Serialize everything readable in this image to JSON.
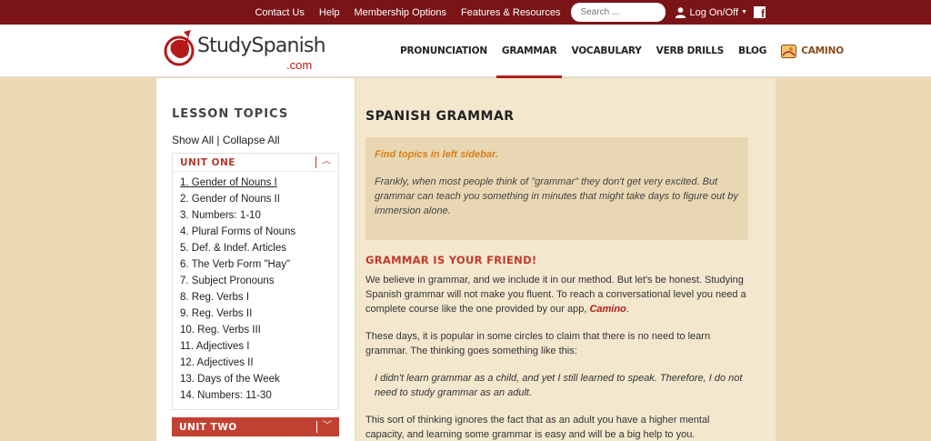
{
  "topbar": {
    "links": [
      "Contact Us",
      "Help",
      "Membership Options",
      "Features & Resources"
    ],
    "search_placeholder": "Search ...",
    "login_label": "Log On/Off"
  },
  "header": {
    "logo_text": "StudySpanish",
    "logo_domain": ".com",
    "nav": [
      "PRONUNCIATION",
      "GRAMMAR",
      "VOCABULARY",
      "VERB DRILLS",
      "BLOG",
      "CAMINO"
    ],
    "active_nav": "GRAMMAR"
  },
  "sidebar": {
    "title": "LESSON TOPICS",
    "show_all": "Show All",
    "separator": " | ",
    "collapse_all": "Collapse All",
    "unit_one": "UNIT ONE",
    "lessons": [
      "1. Gender of Nouns I",
      "2. Gender of Nouns II",
      "3. Numbers: 1-10",
      "4. Plural Forms of Nouns",
      "5. Def. & Indef. Articles",
      "6. The Verb Form \"Hay\"",
      "7. Subject Pronouns",
      "8. Reg. Verbs I",
      "9. Reg. Verbs II",
      "10. Reg. Verbs III",
      "11. Adjectives I",
      "12. Adjectives II",
      "13. Days of the Week",
      "14. Numbers: 11-30"
    ],
    "unit_two": "UNIT TWO"
  },
  "main": {
    "title": "SPANISH GRAMMAR",
    "callout_hint": "Find topics in left sidebar.",
    "callout_text": "Frankly, when most people think of \"grammar\" they don't get very excited. But grammar can teach you something in minutes that might take days to figure out by immersion alone.",
    "subhead": "GRAMMAR IS YOUR FRIEND!",
    "para1_before": "We believe in grammar, and we include it in our method. But let's be honest. Studying Spanish grammar will not make you fluent. To reach a conversational level you need a complete course like the one provided by our app, ",
    "para1_link": "Camino",
    "para1_after": ".",
    "para2": "These days, it is popular in some circles to claim that there is no need to learn grammar. The thinking goes something like this:",
    "quote": "I didn't learn grammar as a child, and yet I still learned to speak. Therefore, I do not need to study grammar as an adult.",
    "para3": "This sort of thinking ignores the fact that as an adult you have a higher mental capacity, and learning some grammar is easy and will be a big help to you."
  },
  "colors": {
    "topbar": "#7a1416",
    "accent": "#b31b1b",
    "unit_two_bg": "#c14133",
    "hint": "#d97f1a",
    "content_bg": "#f3e8ce",
    "page_bg": "#ecd9b3"
  }
}
